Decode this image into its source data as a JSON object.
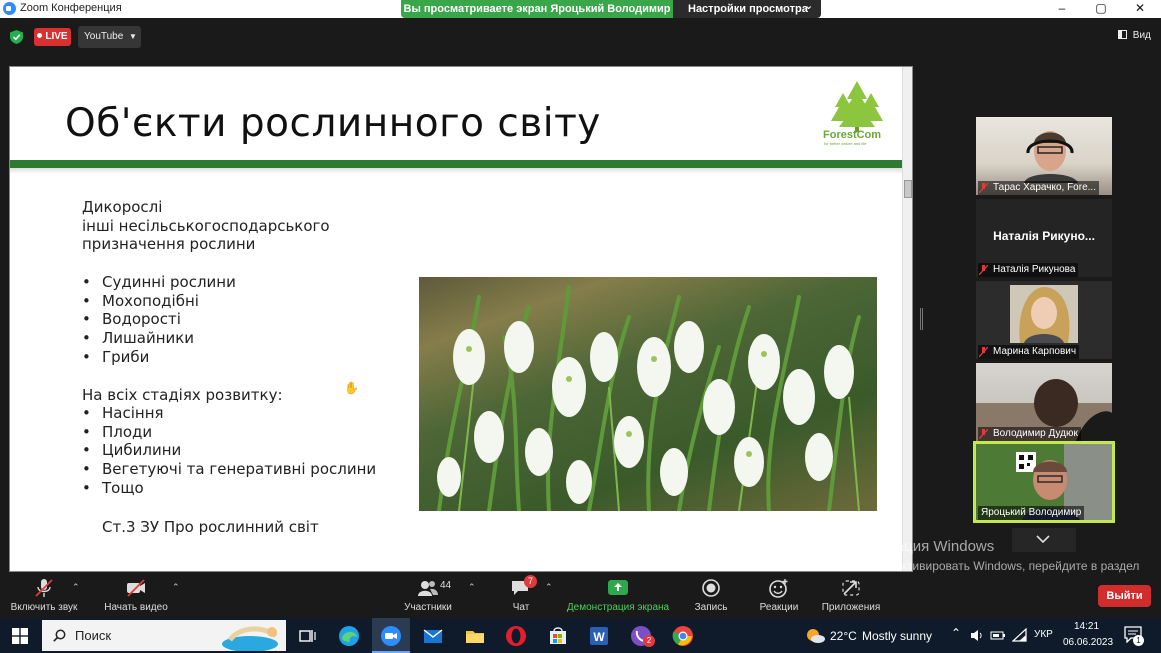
{
  "window": {
    "title": "Zoom Конференция",
    "controls": [
      "–",
      "▢",
      "✕"
    ]
  },
  "share_banner": {
    "viewing": "Вы просматриваете экран Яроцький Володимир",
    "view_settings": "Настройки просмотра",
    "view_settings_caret": "⌄"
  },
  "topbar": {
    "live": "LIVE",
    "youtube": "YouTube",
    "view_label": "Вид"
  },
  "slide": {
    "title": "Об'єкти рослинного світу",
    "logo_name": "ForestCom",
    "logo_tagline": "for better nature and life",
    "intro": [
      "Дикорослі",
      "інші несільськогосподарського",
      "призначення рослини"
    ],
    "list1": [
      "Судинні рослини",
      "Мохоподібні",
      "Водорості",
      "Лишайники",
      "Гриби"
    ],
    "stages_heading": "На всіх стадіях розвитку:",
    "list2": [
      "Насіння",
      "Плоди",
      "Цибилини",
      "Вегетуючі та генеративні рослини",
      "Тощо"
    ],
    "footnote": "Ст.3 ЗУ Про рослинний світ"
  },
  "participants": [
    {
      "name": "Тарас Харачко, Fore...",
      "video": true
    },
    {
      "name": "Наталія Рикунова",
      "display": "Наталія Рикуно...",
      "video": false
    },
    {
      "name": "Марина Карпович",
      "video": true
    },
    {
      "name": "Володимир Дудюк",
      "video": true
    },
    {
      "name": "Яроцький Володимир",
      "video": true,
      "active_speaker": true
    }
  ],
  "activation": {
    "title": "Активация Windows",
    "text": "Чтобы активировать Windows, перейдите в раздел \"Параметры\"."
  },
  "toolbar": {
    "mute": "Включить звук",
    "video": "Начать видео",
    "participants": "Участники",
    "participants_count": "44",
    "chat": "Чат",
    "chat_badge": "7",
    "share": "Демонстрация экрана",
    "record": "Запись",
    "reactions": "Реакции",
    "apps": "Приложения",
    "leave": "Выйти"
  },
  "taskbar": {
    "search": "Поиск",
    "weather_temp": "22°C",
    "weather_text": "Mostly sunny",
    "lang": "УКР",
    "time": "14:21",
    "date": "06.06.2023",
    "notifications": "1",
    "viber_badge": "2"
  },
  "colors": {
    "slide_rule": "#2f7a33",
    "share_green": "#3aa64a",
    "live_red": "#d93131",
    "leave_red": "#d22d2d",
    "active_speaker": "#c5e84f"
  }
}
